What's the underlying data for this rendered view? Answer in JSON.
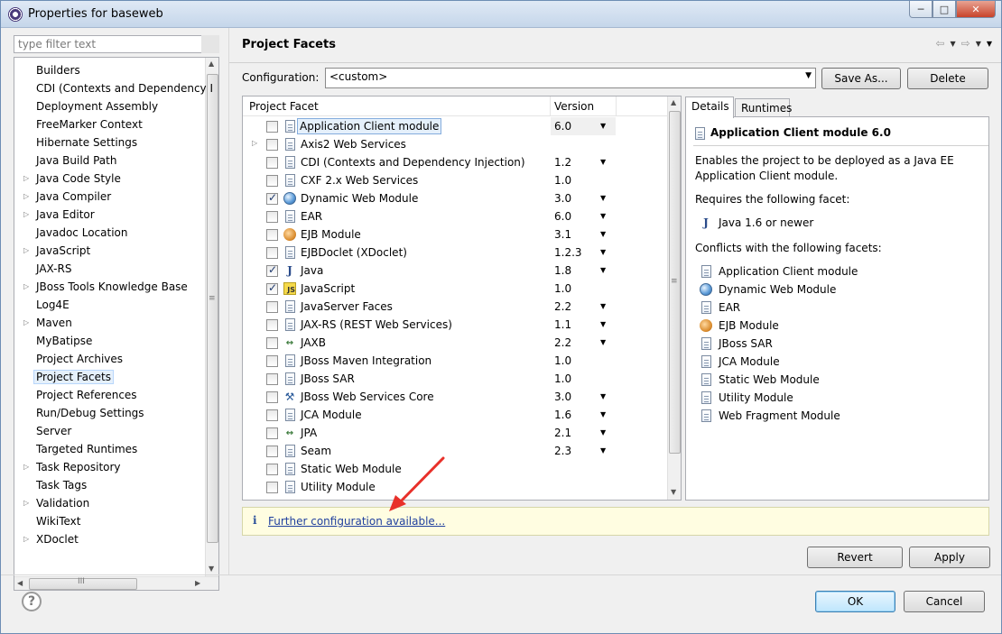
{
  "window": {
    "title": "Properties for baseweb",
    "controls": {
      "minimize": "─",
      "maximize": "□",
      "close": "✕"
    }
  },
  "sidebar": {
    "filter_placeholder": "type filter text",
    "selected": "Project Facets",
    "items": [
      {
        "label": "Builders",
        "expandable": false
      },
      {
        "label": "CDI (Contexts and Dependency I",
        "expandable": false
      },
      {
        "label": "Deployment Assembly",
        "expandable": false
      },
      {
        "label": "FreeMarker Context",
        "expandable": false
      },
      {
        "label": "Hibernate Settings",
        "expandable": false
      },
      {
        "label": "Java Build Path",
        "expandable": false
      },
      {
        "label": "Java Code Style",
        "expandable": true
      },
      {
        "label": "Java Compiler",
        "expandable": true
      },
      {
        "label": "Java Editor",
        "expandable": true
      },
      {
        "label": "Javadoc Location",
        "expandable": false
      },
      {
        "label": "JavaScript",
        "expandable": true
      },
      {
        "label": "JAX-RS",
        "expandable": false
      },
      {
        "label": "JBoss Tools Knowledge Base",
        "expandable": true
      },
      {
        "label": "Log4E",
        "expandable": false
      },
      {
        "label": "Maven",
        "expandable": true
      },
      {
        "label": "MyBatipse",
        "expandable": false
      },
      {
        "label": "Project Archives",
        "expandable": false
      },
      {
        "label": "Project Facets",
        "expandable": false
      },
      {
        "label": "Project References",
        "expandable": false
      },
      {
        "label": "Run/Debug Settings",
        "expandable": false
      },
      {
        "label": "Server",
        "expandable": false
      },
      {
        "label": "Targeted Runtimes",
        "expandable": false
      },
      {
        "label": "Task Repository",
        "expandable": true
      },
      {
        "label": "Task Tags",
        "expandable": false
      },
      {
        "label": "Validation",
        "expandable": true
      },
      {
        "label": "WikiText",
        "expandable": false
      },
      {
        "label": "XDoclet",
        "expandable": true
      }
    ]
  },
  "page": {
    "title": "Project Facets",
    "configuration_label": "Configuration:",
    "configuration_value": "<custom>",
    "save_as_label": "Save As...",
    "delete_label": "Delete"
  },
  "facets_table": {
    "columns": [
      "Project Facet",
      "Version"
    ],
    "rows": [
      {
        "name": "Application Client module",
        "version": "6.0",
        "checked": false,
        "icon": "doc-icon",
        "has_dropdown": true,
        "selected": true,
        "expandable": false
      },
      {
        "name": "Axis2 Web Services",
        "version": "",
        "checked": false,
        "icon": "doc-icon",
        "has_dropdown": false,
        "selected": false,
        "expandable": true
      },
      {
        "name": "CDI (Contexts and Dependency Injection)",
        "version": "1.2",
        "checked": false,
        "icon": "doc-icon",
        "has_dropdown": true,
        "selected": false,
        "expandable": false
      },
      {
        "name": "CXF 2.x Web Services",
        "version": "1.0",
        "checked": false,
        "icon": "doc-icon",
        "has_dropdown": false,
        "selected": false,
        "expandable": false
      },
      {
        "name": "Dynamic Web Module",
        "version": "3.0",
        "checked": true,
        "icon": "globe-icon",
        "has_dropdown": true,
        "selected": false,
        "expandable": false
      },
      {
        "name": "EAR",
        "version": "6.0",
        "checked": false,
        "icon": "doc-icon",
        "has_dropdown": true,
        "selected": false,
        "expandable": false
      },
      {
        "name": "EJB Module",
        "version": "3.1",
        "checked": false,
        "icon": "bean-icon",
        "has_dropdown": true,
        "selected": false,
        "expandable": false
      },
      {
        "name": "EJBDoclet (XDoclet)",
        "version": "1.2.3",
        "checked": false,
        "icon": "doc-icon",
        "has_dropdown": true,
        "selected": false,
        "expandable": false
      },
      {
        "name": "Java",
        "version": "1.8",
        "checked": true,
        "icon": "java-icon",
        "has_dropdown": true,
        "selected": false,
        "expandable": false
      },
      {
        "name": "JavaScript",
        "version": "1.0",
        "checked": true,
        "icon": "javascript-icon",
        "has_dropdown": false,
        "selected": false,
        "expandable": false
      },
      {
        "name": "JavaServer Faces",
        "version": "2.2",
        "checked": false,
        "icon": "doc-icon",
        "has_dropdown": true,
        "selected": false,
        "expandable": false
      },
      {
        "name": "JAX-RS (REST Web Services)",
        "version": "1.1",
        "checked": false,
        "icon": "doc-icon",
        "has_dropdown": true,
        "selected": false,
        "expandable": false
      },
      {
        "name": "JAXB",
        "version": "2.2",
        "checked": false,
        "icon": "arrows-icon",
        "has_dropdown": true,
        "selected": false,
        "expandable": false
      },
      {
        "name": "JBoss Maven Integration",
        "version": "1.0",
        "checked": false,
        "icon": "doc-icon",
        "has_dropdown": false,
        "selected": false,
        "expandable": false
      },
      {
        "name": "JBoss SAR",
        "version": "1.0",
        "checked": false,
        "icon": "doc-icon",
        "has_dropdown": false,
        "selected": false,
        "expandable": false
      },
      {
        "name": "JBoss Web Services Core",
        "version": "3.0",
        "checked": false,
        "icon": "webservice-icon",
        "has_dropdown": true,
        "selected": false,
        "expandable": false
      },
      {
        "name": "JCA Module",
        "version": "1.6",
        "checked": false,
        "icon": "doc-icon",
        "has_dropdown": true,
        "selected": false,
        "expandable": false
      },
      {
        "name": "JPA",
        "version": "2.1",
        "checked": false,
        "icon": "arrows-icon",
        "has_dropdown": true,
        "selected": false,
        "expandable": false
      },
      {
        "name": "Seam",
        "version": "2.3",
        "checked": false,
        "icon": "doc-icon",
        "has_dropdown": true,
        "selected": false,
        "expandable": false
      },
      {
        "name": "Static Web Module",
        "version": "",
        "checked": false,
        "icon": "doc-icon",
        "has_dropdown": false,
        "selected": false,
        "expandable": false
      },
      {
        "name": "Utility Module",
        "version": "",
        "checked": false,
        "icon": "doc-icon",
        "has_dropdown": false,
        "selected": false,
        "expandable": false
      }
    ]
  },
  "details": {
    "tabs": [
      "Details",
      "Runtimes"
    ],
    "active_tab": "Details",
    "title": "Application Client module 6.0",
    "description": "Enables the project to be deployed as a Java EE Application Client module.",
    "requires_label": "Requires the following facet:",
    "requires": [
      {
        "label": "Java 1.6 or newer",
        "icon": "java-icon"
      }
    ],
    "conflicts_label": "Conflicts with the following facets:",
    "conflicts": [
      {
        "label": "Application Client module",
        "icon": "doc-icon"
      },
      {
        "label": "Dynamic Web Module",
        "icon": "globe-icon"
      },
      {
        "label": "EAR",
        "icon": "doc-icon"
      },
      {
        "label": "EJB Module",
        "icon": "bean-icon"
      },
      {
        "label": "JBoss SAR",
        "icon": "doc-icon"
      },
      {
        "label": "JCA Module",
        "icon": "doc-icon"
      },
      {
        "label": "Static Web Module",
        "icon": "doc-icon"
      },
      {
        "label": "Utility Module",
        "icon": "doc-icon"
      },
      {
        "label": "Web Fragment Module",
        "icon": "doc-icon"
      }
    ]
  },
  "info_bar": {
    "icon": "i",
    "link_text": "Further configuration available..."
  },
  "buttons": {
    "revert": "Revert",
    "apply": "Apply",
    "ok": "OK",
    "cancel": "Cancel",
    "help": "?"
  },
  "colors": {
    "annotation_arrow": "#e8302a",
    "selection": "#e5f0fb",
    "link": "#1f3f9e",
    "info_bg": "#fffde1"
  }
}
